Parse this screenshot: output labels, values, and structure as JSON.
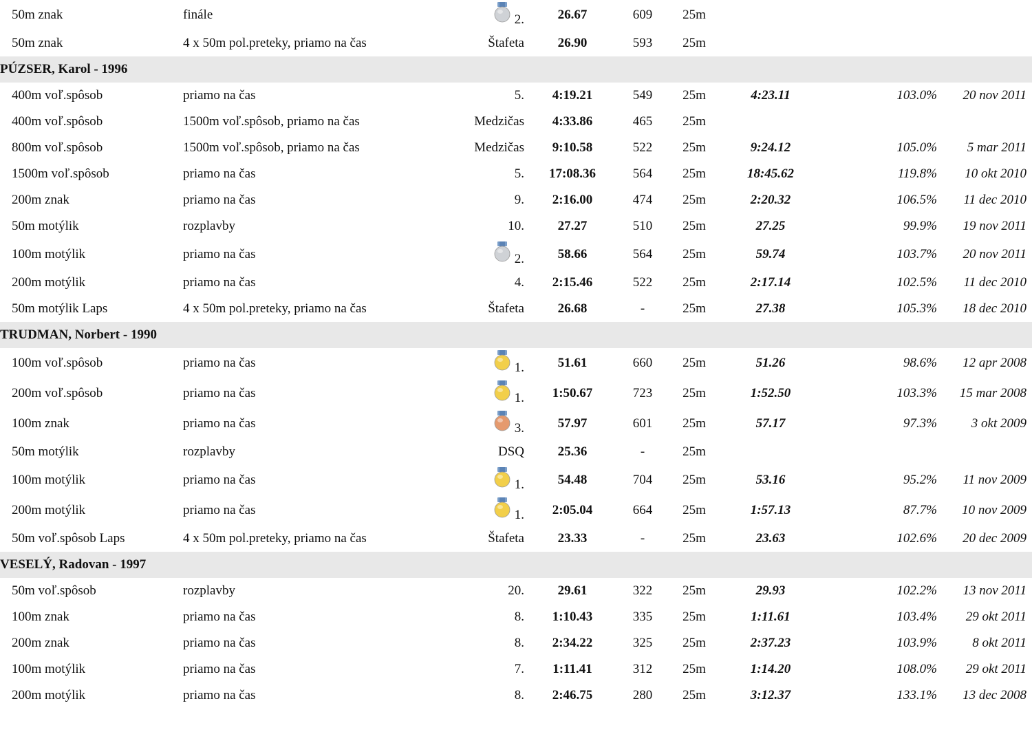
{
  "colors": {
    "gold": "#f2cf4a",
    "silver": "#cfd2d6",
    "bronze": "#e59a6e",
    "ribbon": "#7a9ec9",
    "group_bg": "#e8e8e8"
  },
  "rows": [
    {
      "type": "entry",
      "event": "50m znak",
      "race": "finále",
      "medal": "silver",
      "place": "2.",
      "time": "26.67",
      "points": "609",
      "course": "25m",
      "pb": "",
      "pct": "",
      "date": ""
    },
    {
      "type": "entry",
      "event": "50m znak",
      "race": "4 x 50m pol.preteky, priamo na čas",
      "medal": "",
      "place": "Štafeta",
      "time": "26.90",
      "points": "593",
      "course": "25m",
      "pb": "",
      "pct": "",
      "date": ""
    },
    {
      "type": "group",
      "name": "PÚZSER, Karol - 1996"
    },
    {
      "type": "entry",
      "event": "400m voľ.spôsob",
      "race": "priamo na čas",
      "medal": "",
      "place": "5.",
      "time": "4:19.21",
      "points": "549",
      "course": "25m",
      "pb": "4:23.11",
      "pct": "103.0%",
      "date": "20 nov 2011"
    },
    {
      "type": "entry",
      "event": "400m voľ.spôsob",
      "race": "1500m voľ.spôsob, priamo na čas",
      "medal": "",
      "place": "Medzičas",
      "time": "4:33.86",
      "points": "465",
      "course": "25m",
      "pb": "",
      "pct": "",
      "date": ""
    },
    {
      "type": "entry",
      "event": "800m voľ.spôsob",
      "race": "1500m voľ.spôsob, priamo na čas",
      "medal": "",
      "place": "Medzičas",
      "time": "9:10.58",
      "points": "522",
      "course": "25m",
      "pb": "9:24.12",
      "pct": "105.0%",
      "date": "5 mar 2011"
    },
    {
      "type": "entry",
      "event": "1500m voľ.spôsob",
      "race": "priamo na čas",
      "medal": "",
      "place": "5.",
      "time": "17:08.36",
      "points": "564",
      "course": "25m",
      "pb": "18:45.62",
      "pct": "119.8%",
      "date": "10 okt 2010"
    },
    {
      "type": "entry",
      "event": "200m znak",
      "race": "priamo na čas",
      "medal": "",
      "place": "9.",
      "time": "2:16.00",
      "points": "474",
      "course": "25m",
      "pb": "2:20.32",
      "pct": "106.5%",
      "date": "11 dec 2010"
    },
    {
      "type": "entry",
      "event": "50m motýlik",
      "race": "rozplavby",
      "medal": "",
      "place": "10.",
      "time": "27.27",
      "points": "510",
      "course": "25m",
      "pb": "27.25",
      "pct": "99.9%",
      "date": "19 nov 2011"
    },
    {
      "type": "entry",
      "event": "100m motýlik",
      "race": "priamo na čas",
      "medal": "silver",
      "place": "2.",
      "time": "58.66",
      "points": "564",
      "course": "25m",
      "pb": "59.74",
      "pct": "103.7%",
      "date": "20 nov 2011"
    },
    {
      "type": "entry",
      "event": "200m motýlik",
      "race": "priamo na čas",
      "medal": "",
      "place": "4.",
      "time": "2:15.46",
      "points": "522",
      "course": "25m",
      "pb": "2:17.14",
      "pct": "102.5%",
      "date": "11 dec 2010"
    },
    {
      "type": "entry",
      "event": "50m motýlik Laps",
      "race": "4 x 50m pol.preteky, priamo na čas",
      "medal": "",
      "place": "Štafeta",
      "time": "26.68",
      "points": "-",
      "course": "25m",
      "pb": "27.38",
      "pct": "105.3%",
      "date": "18 dec 2010"
    },
    {
      "type": "group",
      "name": "TRUDMAN, Norbert - 1990"
    },
    {
      "type": "entry",
      "event": "100m voľ.spôsob",
      "race": "priamo na čas",
      "medal": "gold",
      "place": "1.",
      "time": "51.61",
      "points": "660",
      "course": "25m",
      "pb": "51.26",
      "pct": "98.6%",
      "date": "12 apr 2008"
    },
    {
      "type": "entry",
      "event": "200m voľ.spôsob",
      "race": "priamo na čas",
      "medal": "gold",
      "place": "1.",
      "time": "1:50.67",
      "points": "723",
      "course": "25m",
      "pb": "1:52.50",
      "pct": "103.3%",
      "date": "15 mar 2008"
    },
    {
      "type": "entry",
      "event": "100m znak",
      "race": "priamo na čas",
      "medal": "bronze",
      "place": "3.",
      "time": "57.97",
      "points": "601",
      "course": "25m",
      "pb": "57.17",
      "pct": "97.3%",
      "date": "3 okt 2009"
    },
    {
      "type": "entry",
      "event": "50m motýlik",
      "race": "rozplavby",
      "medal": "",
      "place": "DSQ",
      "time": "25.36",
      "points": "-",
      "course": "25m",
      "pb": "",
      "pct": "",
      "date": ""
    },
    {
      "type": "entry",
      "event": "100m motýlik",
      "race": "priamo na čas",
      "medal": "gold",
      "place": "1.",
      "time": "54.48",
      "points": "704",
      "course": "25m",
      "pb": "53.16",
      "pct": "95.2%",
      "date": "11 nov 2009"
    },
    {
      "type": "entry",
      "event": "200m motýlik",
      "race": "priamo na čas",
      "medal": "gold",
      "place": "1.",
      "time": "2:05.04",
      "points": "664",
      "course": "25m",
      "pb": "1:57.13",
      "pct": "87.7%",
      "date": "10 nov 2009"
    },
    {
      "type": "entry",
      "event": "50m voľ.spôsob Laps",
      "race": "4 x 50m pol.preteky, priamo na čas",
      "medal": "",
      "place": "Štafeta",
      "time": "23.33",
      "points": "-",
      "course": "25m",
      "pb": "23.63",
      "pct": "102.6%",
      "date": "20 dec 2009"
    },
    {
      "type": "group",
      "name": "VESELÝ, Radovan - 1997"
    },
    {
      "type": "entry",
      "event": "50m voľ.spôsob",
      "race": "rozplavby",
      "medal": "",
      "place": "20.",
      "time": "29.61",
      "points": "322",
      "course": "25m",
      "pb": "29.93",
      "pct": "102.2%",
      "date": "13 nov 2011"
    },
    {
      "type": "entry",
      "event": "100m znak",
      "race": "priamo na čas",
      "medal": "",
      "place": "8.",
      "time": "1:10.43",
      "points": "335",
      "course": "25m",
      "pb": "1:11.61",
      "pct": "103.4%",
      "date": "29 okt 2011"
    },
    {
      "type": "entry",
      "event": "200m znak",
      "race": "priamo na čas",
      "medal": "",
      "place": "8.",
      "time": "2:34.22",
      "points": "325",
      "course": "25m",
      "pb": "2:37.23",
      "pct": "103.9%",
      "date": "8 okt 2011"
    },
    {
      "type": "entry",
      "event": "100m motýlik",
      "race": "priamo na čas",
      "medal": "",
      "place": "7.",
      "time": "1:11.41",
      "points": "312",
      "course": "25m",
      "pb": "1:14.20",
      "pct": "108.0%",
      "date": "29 okt 2011"
    },
    {
      "type": "entry",
      "event": "200m motýlik",
      "race": "priamo na čas",
      "medal": "",
      "place": "8.",
      "time": "2:46.75",
      "points": "280",
      "course": "25m",
      "pb": "3:12.37",
      "pct": "133.1%",
      "date": "13 dec 2008"
    }
  ]
}
